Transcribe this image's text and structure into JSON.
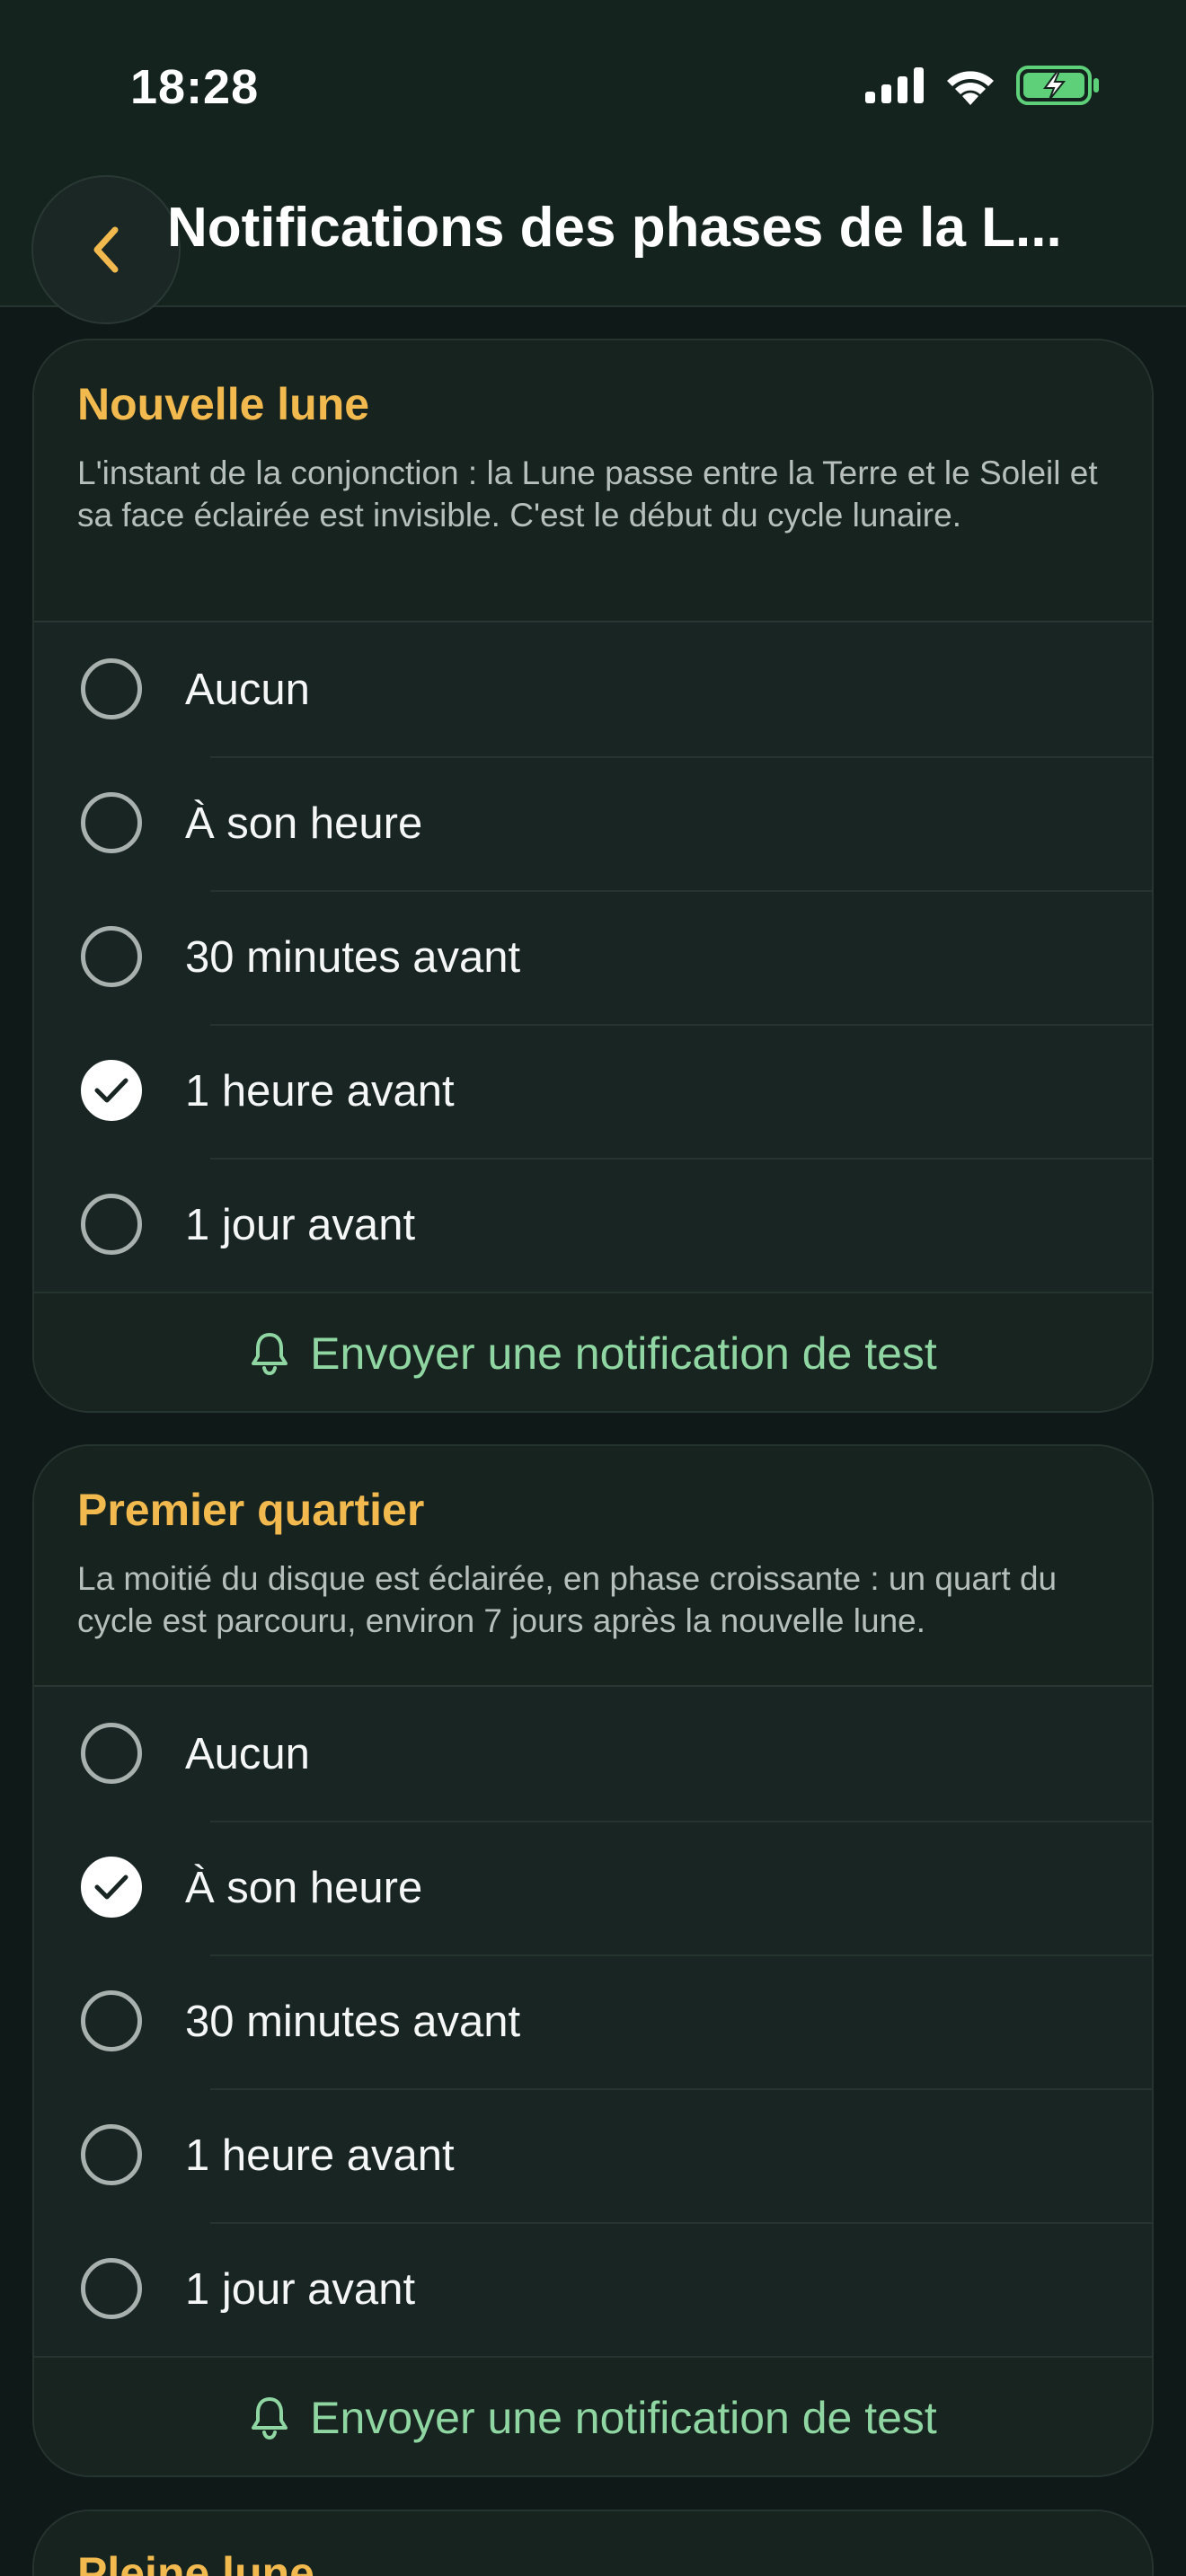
{
  "status": {
    "time": "18:28"
  },
  "nav": {
    "title": "Notifications des phases de la L..."
  },
  "phases": [
    {
      "title": "Nouvelle lune",
      "description": "L'instant de la conjonction : la Lune passe entre la Terre et le Soleil et sa face éclairée est invisible. C'est le début du cycle lunaire.",
      "options": [
        "Aucun",
        "À son heure",
        "30 minutes avant",
        "1 heure avant",
        "1 jour avant"
      ],
      "selected_index": 3,
      "test_label": "Envoyer une notification de test"
    },
    {
      "title": "Premier quartier",
      "description": "La moitié du disque est éclairée, en phase croissante : un quart du cycle est parcouru, environ 7 jours après la nouvelle lune.",
      "options": [
        "Aucun",
        "À son heure",
        "30 minutes avant",
        "1 heure avant",
        "1 jour avant"
      ],
      "selected_index": 1,
      "test_label": "Envoyer une notification de test"
    },
    {
      "title": "Pleine lune"
    }
  ],
  "colors": {
    "accent_title": "#f1b94e",
    "accent_action": "#8fd6a2",
    "battery": "#5fd07a"
  }
}
